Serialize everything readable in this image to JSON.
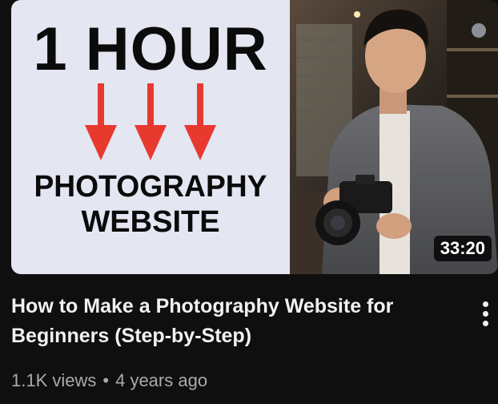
{
  "thumbnail": {
    "headline_top": "1 HOUR",
    "headline_mid": "PHOTOGRAPHY",
    "headline_bottom": "WEBSITE",
    "arrow_color": "#e8392e",
    "left_panel_color": "#e4e6f2",
    "duration": "33:20"
  },
  "video": {
    "title_line1": "How to Make a Photography Website for",
    "title_line2": "Beginners (Step-by-Step)",
    "views": "1.1K views",
    "separator": "•",
    "age": "4 years ago"
  },
  "menu": {
    "icon": "more-vert-icon"
  }
}
